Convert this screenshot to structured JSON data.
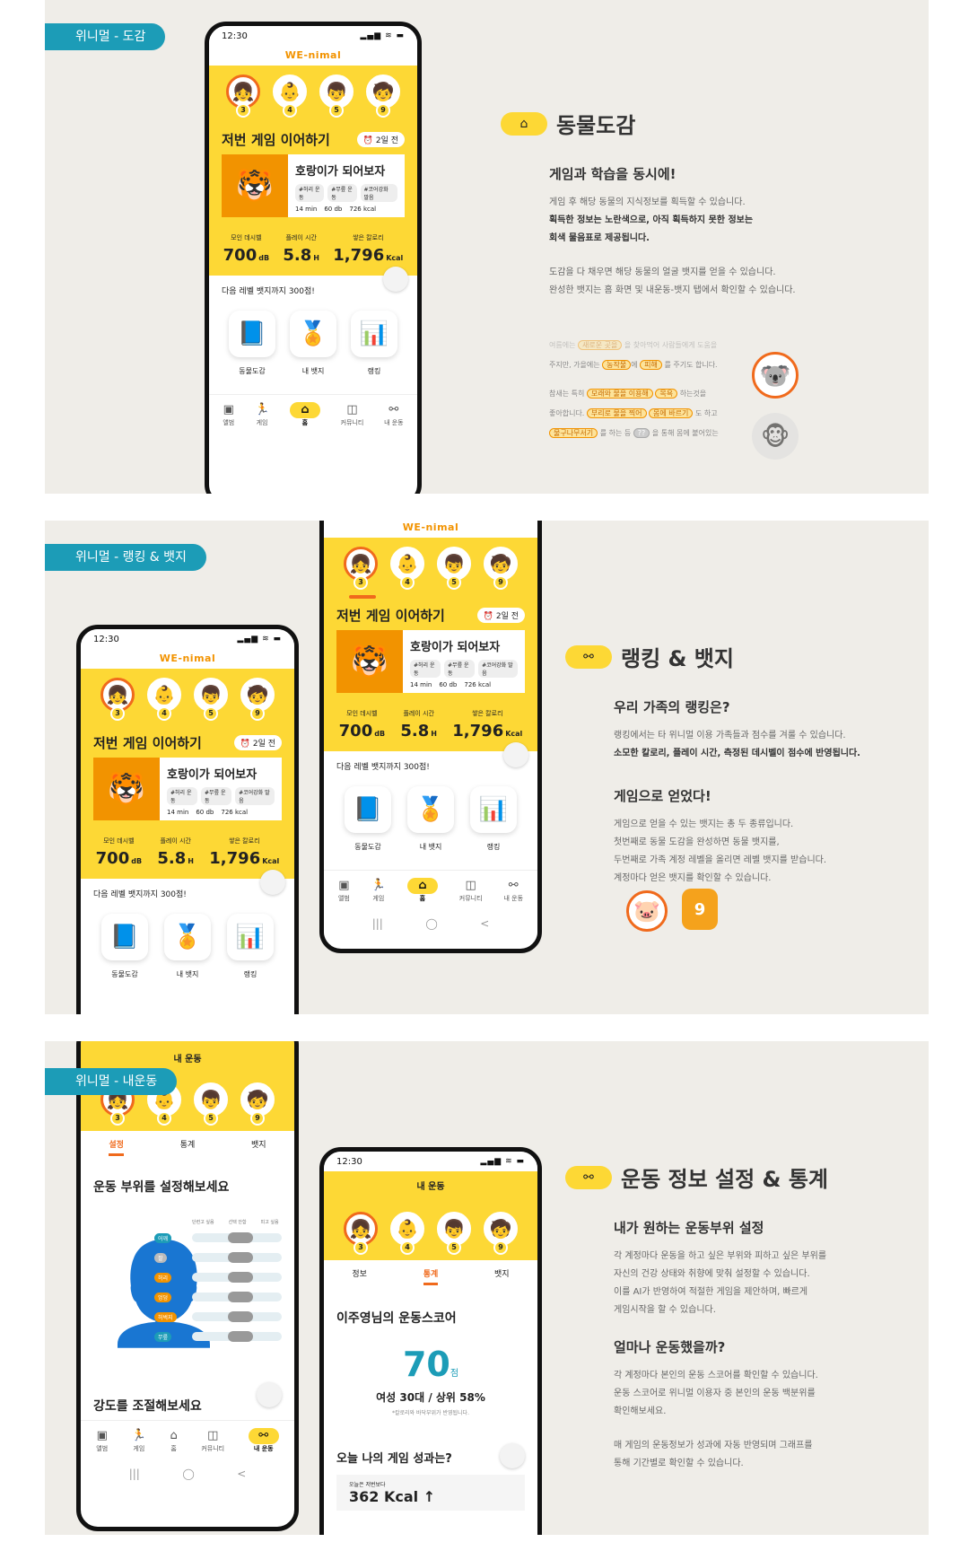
{
  "common": {
    "time": "12:30",
    "status_icons": "▂▄▆ ≋ ▬",
    "brand": "WE-nimal",
    "avatar_nums": [
      "3",
      "4",
      "5",
      "9"
    ],
    "continue": "저번 게임 이어하기",
    "ago": "2일 전",
    "game_name": "호랑이가 되어보자",
    "chips": [
      "#허리 운동",
      "#무릎 운동",
      "#코어강화 말음"
    ],
    "game_stats": [
      "14 min",
      "60 db",
      "726 kcal"
    ],
    "stat_labels": [
      "모인 데시벨",
      "플레이 시간",
      "쌓은 칼로리"
    ],
    "stat_vals": [
      "700",
      "5.8",
      "1,796"
    ],
    "stat_units": [
      "dB",
      "H",
      "Kcal"
    ],
    "next_level": "다음 레벨 뱃지까지 300점!",
    "menu": [
      "동물도감",
      "내 뱃지",
      "랭킹"
    ],
    "tabs": [
      "앨범",
      "게임",
      "홈",
      "커뮤니티",
      "내 운동"
    ],
    "nav": [
      "|||",
      "◯",
      "<"
    ]
  },
  "s1": {
    "tag": "위니멀 - 도감",
    "title": "동물도감",
    "h3": "게임과 학습을 동시에!",
    "p1a": "게임 후 해당 동물의 지식정보를 획득할 수 있습니다.",
    "p1b": "획득한 정보는 노란색으로, 아직 획득하지 못한 정보는",
    "p1c": "회색 물음표로 제공됩니다.",
    "p2a": "도감을 다 채우면 해당 동물의 얼굴 뱃지를 얻을 수 있습니다.",
    "p2b": "완성한 뱃지는 홈 화면 및 내운동-뱃지 탭에서 확인할 수 있습니다.",
    "c1": "여름에는",
    "c1h": "새로운 곳을",
    "c1t": "을 찾아먹어 사람들에게 도움을",
    "c2": "주지만, 가을에는",
    "c2h1": "농작물",
    "c2m": "에",
    "c2h2": "피해",
    "c2t": "를 주기도 합니다.",
    "c3": "참새는 특히",
    "c3h1": "모래와 물을 이용해",
    "c3h2": "목욕",
    "c3t": "하는것을",
    "c4": "좋아합니다.",
    "c4h1": "부리로 물을 찍어",
    "c4h2": "몸에 바르기",
    "c4t": "도 하고",
    "c5h": "물구나무서기",
    "c5t": "를 하는 등",
    "c5q": "??",
    "c5e": "을 통해 몸에 붙어있는"
  },
  "s2": {
    "tag": "위니멀 - 랭킹 & 뱃지",
    "title": "랭킹 & 뱃지",
    "h3a": "우리 가족의 랭킹은?",
    "pa1": "랭킹에서는 타 위니멀 이용 가족들과 점수를 겨룰 수 있습니다.",
    "pa2": "소모한 칼로리, 플레이 시간, 측정된 데시벨이 점수에 반영됩니다.",
    "h3b": "게임으로 얻었다!",
    "pb1": "게임으로 얻을 수 있는 뱃지는 총 두 종류입니다.",
    "pb2": "첫번째로 동물 도감을 완성하면 동물 뱃지를,",
    "pb3": "두번째로 가족 계정 레벨을 올리면 레벨 뱃지를 받습니다.",
    "pb4": "계정마다 얻은 뱃지를 확인할 수 있습니다.",
    "badge_num": "9"
  },
  "s3": {
    "tag": "위니멀 - 내운동",
    "title": "운동 정보 설정 & 통계",
    "my_ex": "내 운동",
    "set_tabs": [
      "설정",
      "통계",
      "뱃지"
    ],
    "stat_tabs": [
      "정보",
      "통계",
      "뱃지"
    ],
    "set_title": "운동 부위를 설정해보세요",
    "cols": [
      "단련고 싶음",
      "선택 안함",
      "피고 싶음"
    ],
    "parts": [
      "어깨",
      "팔",
      "허리",
      "엉덩",
      "허벅지",
      "무릎"
    ],
    "intensity": "강도를 조절해보세요",
    "score_title": "이주영님의 운동스코어",
    "score": "70",
    "score_unit": "점",
    "rank": "여성 30대  /  상위 58%",
    "rank_note": "*칼로리와 바닥부위가 반영됩니다.",
    "today": "오늘 나의 게임 성과는?",
    "today_sub": "오늘은 저번보다",
    "kcal": "362 Kcal ↑",
    "h3a": "내가 원하는 운동부위 설정",
    "pa1": "각 계정마다 운동을 하고 싶은 부위와 피하고 싶은 부위를",
    "pa2": "자신의 건강 상태와 취향에 맞춰 설정할 수 있습니다.",
    "pa3": "이를 AI가 반영하여 적절한 게임을 제안하며, 빠르게",
    "pa4": "게임시작을 할 수 있습니다.",
    "h3b": "얼마나 운동했을까?",
    "pb1": "각 계정마다 본인의 운동 스코어를 확인할 수 있습니다.",
    "pb2": "운동 스코어로 위니멀 이용자 중 본인의 운동 백분위를",
    "pb3": "확인해보세요.",
    "pb4": "매 게임의 운동정보가 성과에 자동 반영되며 그래프를",
    "pb5": "통해 기간별로 확인할 수 있습니다."
  }
}
